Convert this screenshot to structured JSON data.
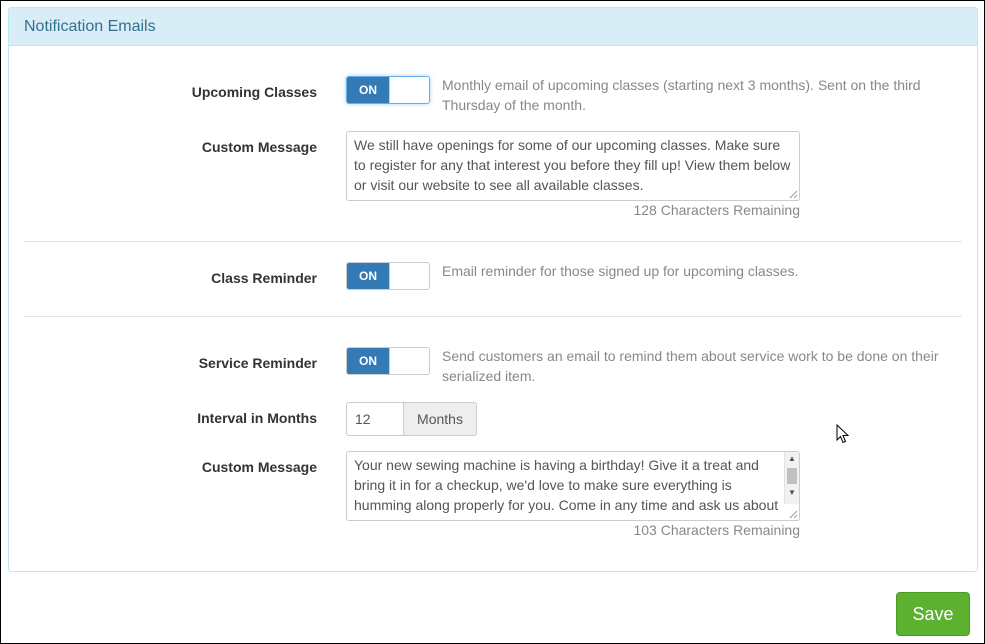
{
  "panel": {
    "title": "Notification Emails"
  },
  "upcoming_classes": {
    "label": "Upcoming Classes",
    "toggle": "ON",
    "help": "Monthly email of upcoming classes (starting next 3 months). Sent on the third Thursday of the month.",
    "custom_message_label": "Custom Message",
    "custom_message": "We still have openings for some of our upcoming classes. Make sure to register for any that interest you before they fill up! View them below or visit our website to see all available classes.",
    "remaining": "128 Characters Remaining"
  },
  "class_reminder": {
    "label": "Class Reminder",
    "toggle": "ON",
    "help": "Email reminder for those signed up for upcoming classes."
  },
  "service_reminder": {
    "label": "Service Reminder",
    "toggle": "ON",
    "help": "Send customers an email to remind them about service work to be done on their serialized item.",
    "interval_label": "Interval in Months",
    "interval_value": "12",
    "interval_unit": "Months",
    "custom_message_label": "Custom Message",
    "custom_message": "Your new sewing machine is having a birthday! Give it a treat and bring it in for a checkup, we'd love to make sure everything is humming along properly for you. Come in any time and ask us about service specials.",
    "remaining": "103 Characters Remaining"
  },
  "actions": {
    "save": "Save"
  },
  "colors": {
    "accent": "#337ab7",
    "panel_heading_bg": "#d9edf7",
    "panel_heading_text": "#31708f",
    "save_button": "#5cb130"
  },
  "icons": {
    "cursor": "mouse-pointer-icon",
    "resize": "resize-grip-icon",
    "scroll_up": "scroll-up-arrow-icon",
    "scroll_down": "scroll-down-arrow-icon"
  }
}
